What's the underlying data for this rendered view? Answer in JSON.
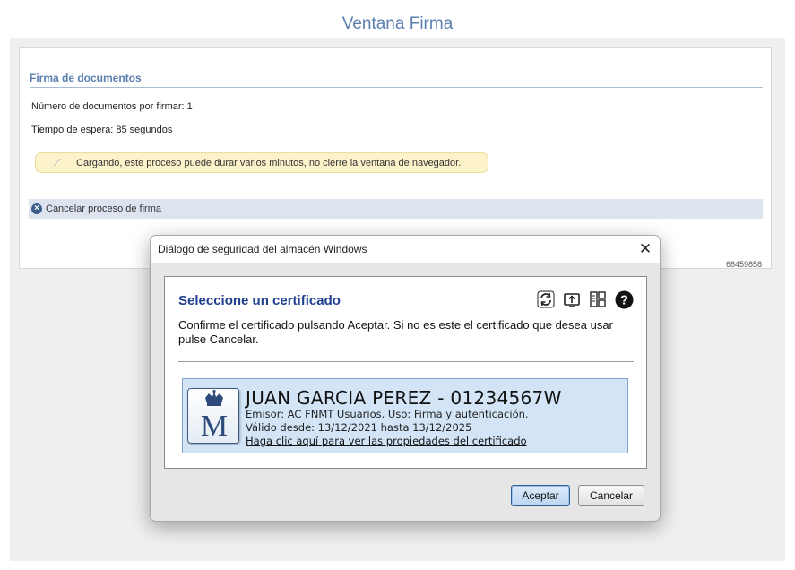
{
  "page": {
    "title": "Ventana Firma"
  },
  "panel": {
    "section_title": "Firma de documentos",
    "docs_pending": "Número de documentos por firmar: 1",
    "wait_time": "Tiempo de espera: 85 segundos",
    "loading_message": "Cargando, este proceso puede durar varios minutos, no cierre la ventana de navegador.",
    "cancel_label": "Cancelar proceso de firma",
    "reference": "68459858"
  },
  "dialog": {
    "title": "Diálogo de seguridad del almacén Windows",
    "select_title": "Seleccione un certificado",
    "instructions": "Confirme el certificado pulsando Aceptar. Si no es este el certificado que desea usar pulse Cancelar.",
    "toolbar_icons": [
      "refresh-icon",
      "import-icon",
      "details-icon",
      "help-icon"
    ],
    "certificate": {
      "name": "JUAN GARCIA PEREZ - 01234567W",
      "issuer": "Emisor: AC FNMT Usuarios. Uso: Firma y autenticación.",
      "validity": "Válido desde: 13/12/2021 hasta 13/12/2025",
      "properties_link": "Haga clic aquí para ver las propiedades del certificado",
      "logo_letter": "M"
    },
    "accept_label": "Aceptar",
    "cancel_label": "Cancelar"
  },
  "colors": {
    "title_blue": "#5b7fae",
    "dialog_heading": "#1f3f8f",
    "cert_bg": "#d3e4f7",
    "loading_bg": "#fcf3cb"
  }
}
